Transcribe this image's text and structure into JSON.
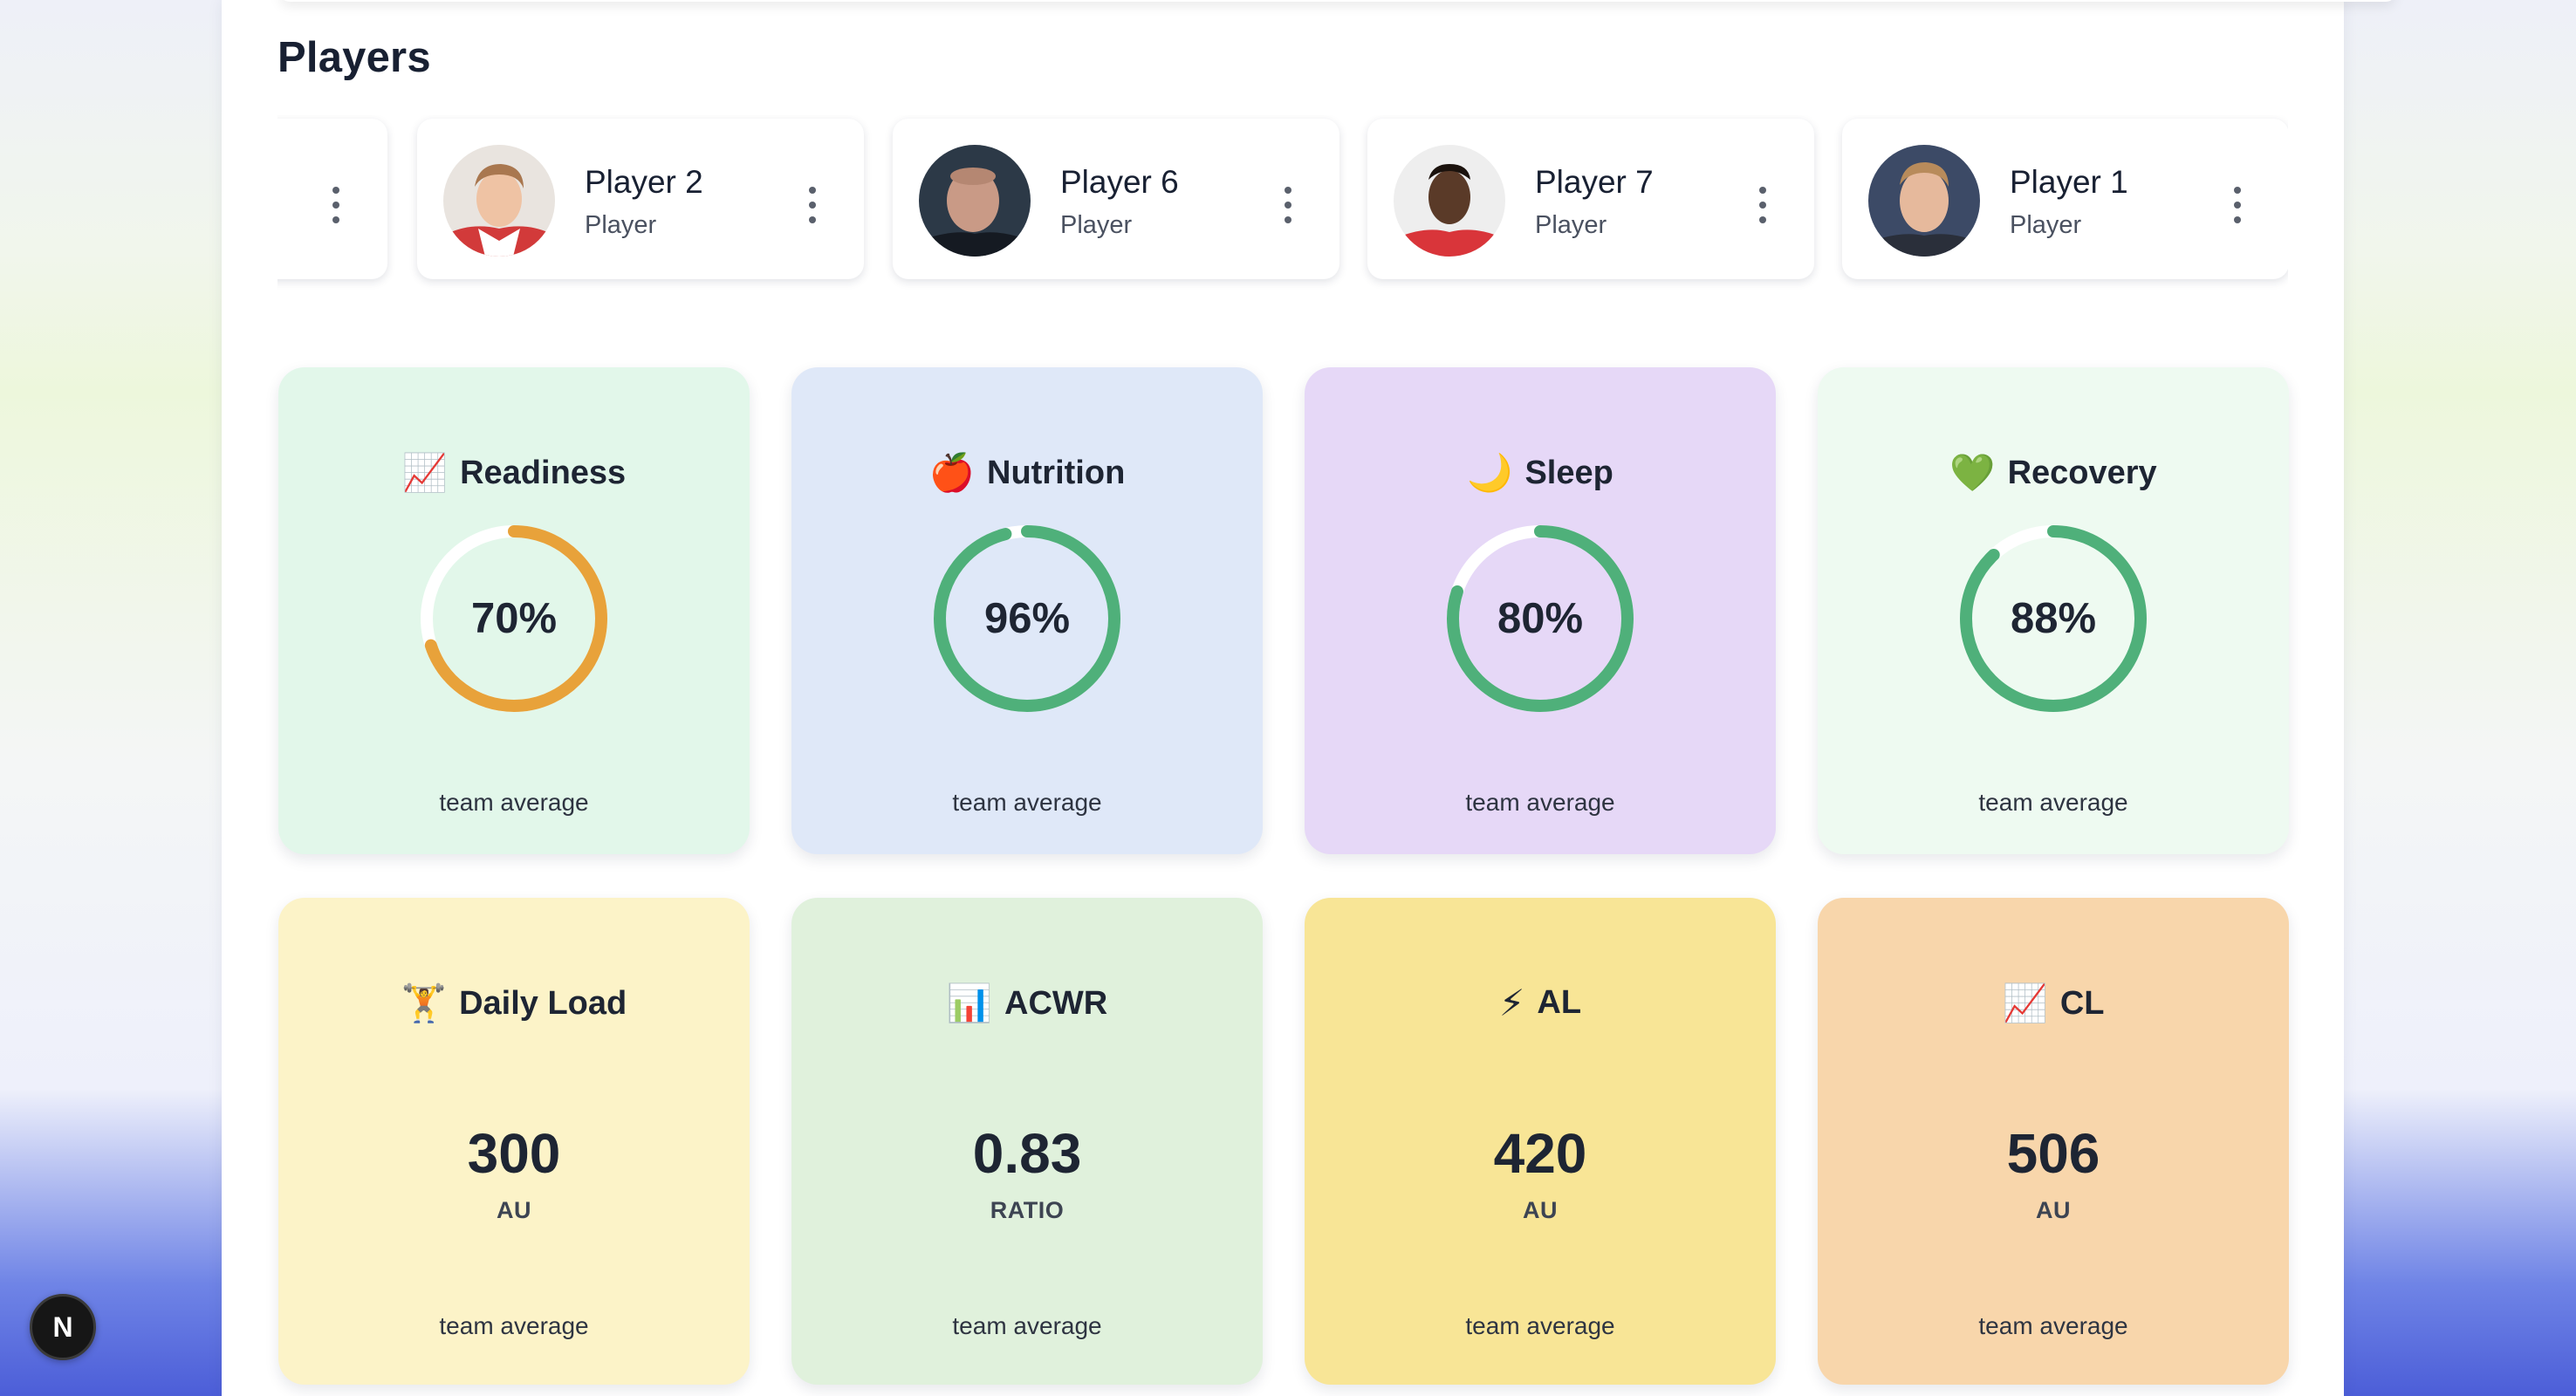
{
  "section": {
    "title": "Players"
  },
  "players": [
    {
      "name": "",
      "role": ""
    },
    {
      "name": "Player 2",
      "role": "Player"
    },
    {
      "name": "Player 6",
      "role": "Player"
    },
    {
      "name": "Player 7",
      "role": "Player"
    },
    {
      "name": "Player 1",
      "role": "Player"
    }
  ],
  "wellness": [
    {
      "label": "Readiness",
      "icon": "chart-increasing-icon",
      "emoji": "📈",
      "value_text": "70%",
      "percent": 70,
      "color": "#e8a23a",
      "caption": "team average",
      "bg": "#e2f7ea"
    },
    {
      "label": "Nutrition",
      "icon": "apple-icon",
      "emoji": "🍎",
      "value_text": "96%",
      "percent": 96,
      "color": "#4fb07a",
      "caption": "team average",
      "bg": "#dfe8f8"
    },
    {
      "label": "Sleep",
      "icon": "crescent-moon-icon",
      "emoji": "🌙",
      "value_text": "80%",
      "percent": 80,
      "color": "#4fb07a",
      "caption": "team average",
      "bg": "#e6d8f7"
    },
    {
      "label": "Recovery",
      "icon": "green-heart-icon",
      "emoji": "💚",
      "value_text": "88%",
      "percent": 88,
      "color": "#4fb07a",
      "caption": "team average",
      "bg": "#eefaf1"
    }
  ],
  "load": [
    {
      "label": "Daily Load",
      "icon": "weightlifter-icon",
      "emoji": "🏋",
      "value": "300",
      "unit": "AU",
      "caption": "team average",
      "bg": "#fcf3c8"
    },
    {
      "label": "ACWR",
      "icon": "bar-chart-icon",
      "emoji": "📊",
      "value": "0.83",
      "unit": "RATIO",
      "caption": "team average",
      "bg": "#e0f1dc"
    },
    {
      "label": "AL",
      "icon": "lightning-icon",
      "emoji": "⚡",
      "value": "420",
      "unit": "AU",
      "caption": "team average",
      "bg": "#f8e596"
    },
    {
      "label": "CL",
      "icon": "chart-increasing-icon",
      "emoji": "📈",
      "value": "506",
      "unit": "AU",
      "caption": "team average",
      "bg": "#f8d6ab"
    }
  ],
  "dev_badge": {
    "label": "N"
  },
  "colors": {
    "track": "#ffffff",
    "good": "#4fb07a",
    "warn": "#e8a23a"
  }
}
